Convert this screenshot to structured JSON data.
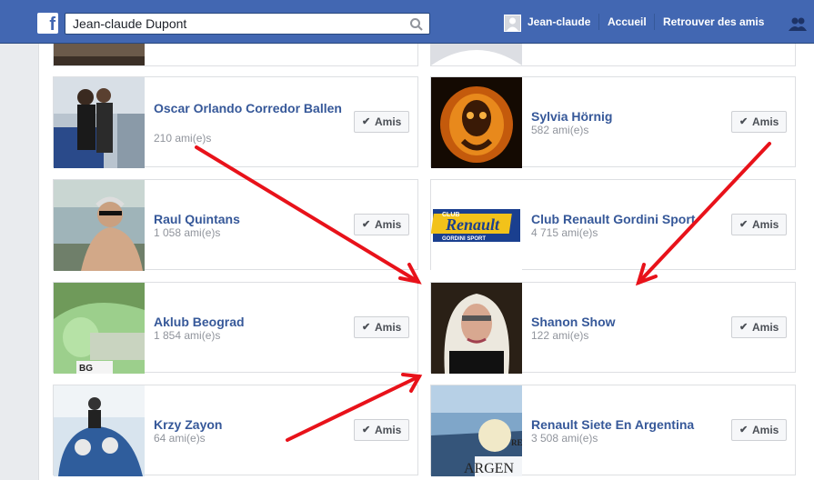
{
  "topbar": {
    "search_value": "Jean-claude Dupont",
    "user_name": "Jean-claude",
    "nav_home": "Accueil",
    "nav_find_friends": "Retrouver des amis"
  },
  "friends": [
    {
      "name": "Oscar Orlando Corredor Ballen",
      "count": "210 ami(e)s",
      "button": "Amis"
    },
    {
      "name": "Sylvia Hörnig",
      "count": "582 ami(e)s",
      "button": "Amis"
    },
    {
      "name": "Raul Quintans",
      "count": "1 058 ami(e)s",
      "button": "Amis"
    },
    {
      "name": "Club Renault Gordini Sport",
      "count": "4 715 ami(e)s",
      "button": "Amis"
    },
    {
      "name": "Aklub Beograd",
      "count": "1 854 ami(e)s",
      "button": "Amis"
    },
    {
      "name": "Shanon Show",
      "count": "122 ami(e)s",
      "button": "Amis"
    },
    {
      "name": "Krzy Zayon",
      "count": "64 ami(e)s",
      "button": "Amis"
    },
    {
      "name": "Renault Siete En Argentina",
      "count": "3 508 ami(e)s",
      "button": "Amis"
    }
  ],
  "thumb_text": {
    "club_logo_top": "CLUB",
    "club_logo_brand": "Renault",
    "club_logo_sub": "GORDINI SPORT",
    "plate": "BG",
    "argentina_top": "RENA",
    "argentina_bottom": "ARGEN"
  },
  "annotation_color": "#e8121a"
}
